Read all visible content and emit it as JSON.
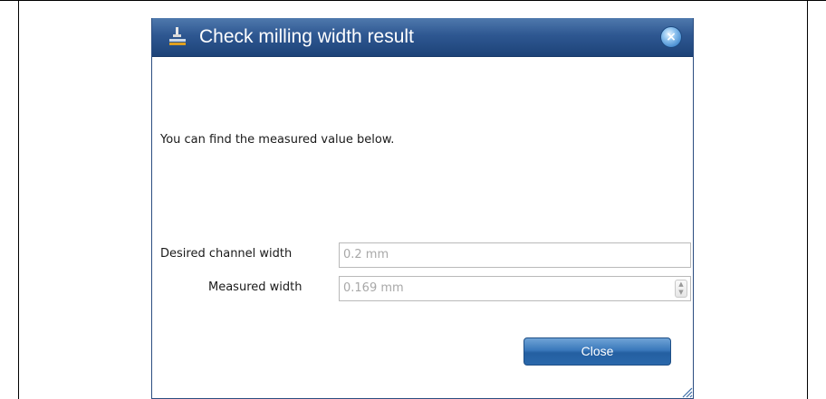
{
  "dialog": {
    "title": "Check milling width result",
    "message": "You can find the measured value below.",
    "fields": {
      "desired_label": "Desired channel width",
      "desired_value": "0.2 mm",
      "measured_label": "Measured width",
      "measured_value": "0.169 mm"
    },
    "close_button": "Close"
  },
  "icons": {
    "app": "milling-icon",
    "close": "close-circle-icon",
    "spin_up": "chevron-up-icon",
    "spin_down": "chevron-down-icon",
    "resize": "resize-grip-icon"
  },
  "colors": {
    "titlebar": "#2e5791",
    "button": "#3a78bb",
    "field_text": "#a8a8a8"
  }
}
